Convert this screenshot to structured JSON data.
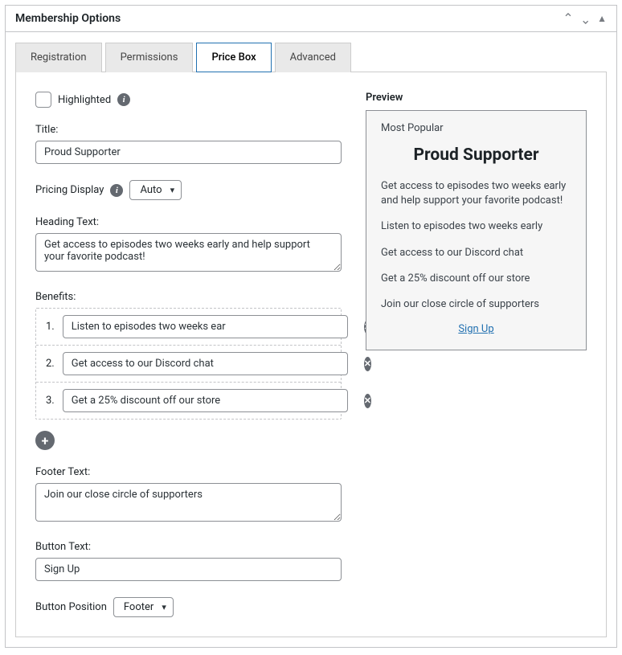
{
  "header": {
    "title": "Membership Options"
  },
  "tabs": [
    {
      "label": "Registration"
    },
    {
      "label": "Permissions"
    },
    {
      "label": "Price Box"
    },
    {
      "label": "Advanced"
    }
  ],
  "fields": {
    "highlighted_label": "Highlighted",
    "title_label": "Title:",
    "title_value": "Proud Supporter",
    "pricing_display_label": "Pricing Display",
    "pricing_display_value": "Auto",
    "heading_text_label": "Heading Text:",
    "heading_text_value": "Get access to episodes two weeks early and help support your favorite podcast!",
    "benefits_label": "Benefits:",
    "benefits": [
      {
        "num": "1.",
        "value": "Listen to episodes two weeks ear"
      },
      {
        "num": "2.",
        "value": "Get access to our Discord chat"
      },
      {
        "num": "3.",
        "value": "Get a 25% discount off our store"
      }
    ],
    "footer_text_label": "Footer Text:",
    "footer_text_value": "Join our close circle of supporters",
    "button_text_label": "Button Text:",
    "button_text_value": "Sign Up",
    "button_position_label": "Button Position",
    "button_position_value": "Footer"
  },
  "preview": {
    "section_title": "Preview",
    "badge": "Most Popular",
    "title": "Proud Supporter",
    "heading": "Get access to episodes two weeks early and help support your favorite podcast!",
    "lines": [
      "Listen to episodes two weeks early",
      "Get access to our Discord chat",
      "Get a 25% discount off our store",
      "Join our close circle of supporters"
    ],
    "link": "Sign Up"
  }
}
